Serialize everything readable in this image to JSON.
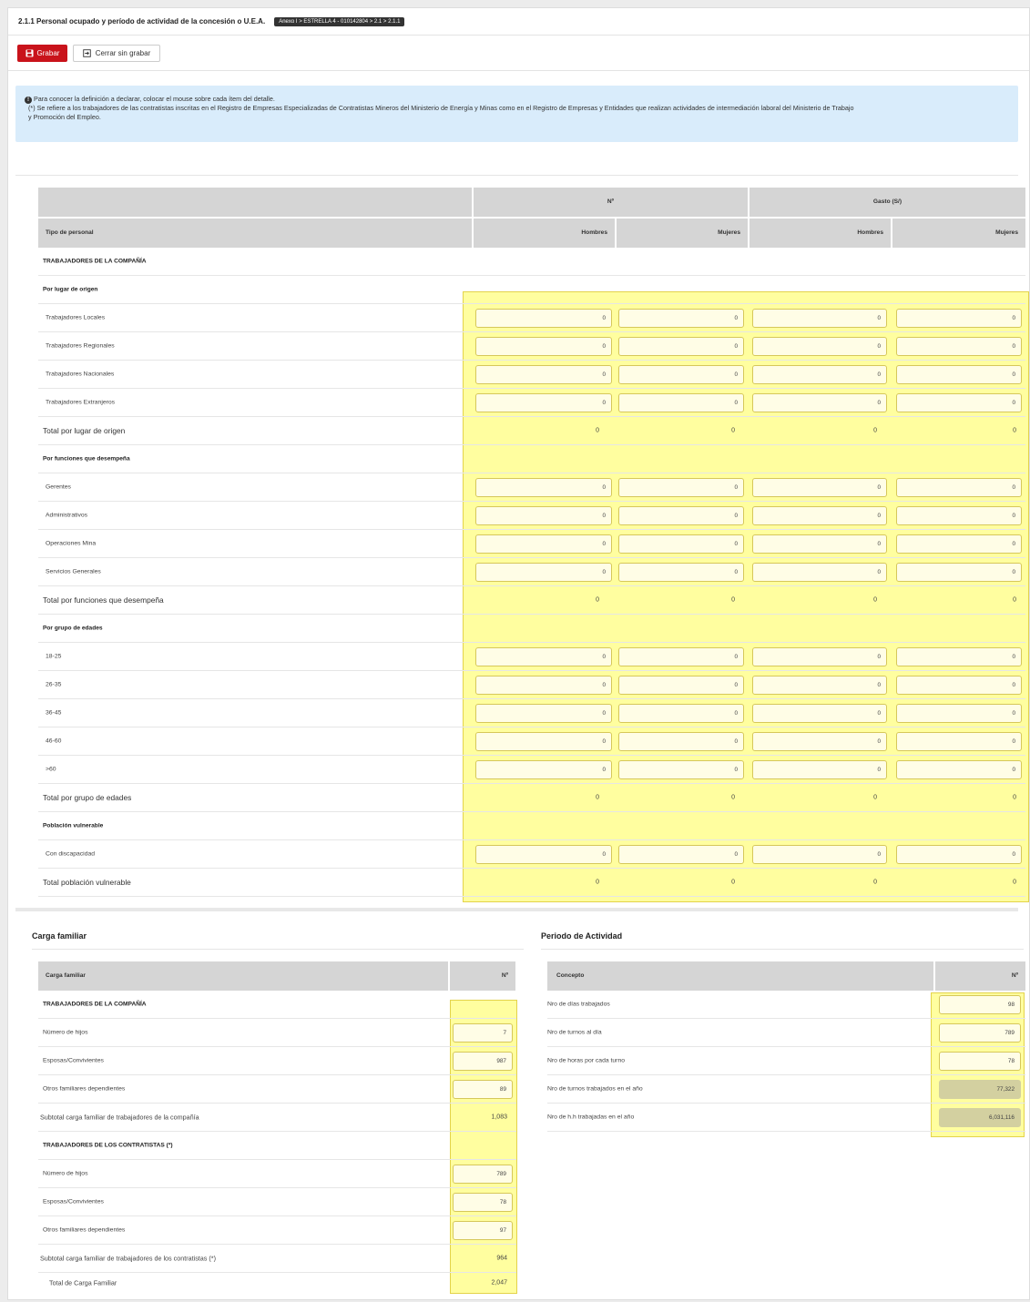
{
  "header": {
    "title": "2.1.1 Personal ocupado y período de actividad de la concesión o U.E.A.",
    "breadcrumb": "Anexo I > ESTRELLA 4 - 010142804 > 2.1 > 2.1.1"
  },
  "toolbar": {
    "save_label": "Grabar",
    "close_label": "Cerrar sin grabar"
  },
  "info": {
    "line1": "Para conocer la definición a declarar, colocar el mouse sobre cada ítem del detalle.",
    "line2": "(*) Se refiere a los trabajadores de las contratistas inscritas en el Registro de Empresas Especializadas de Contratistas Mineros del Ministerio de Energía y Minas como en el Registro de Empresas y Entidades que realizan actividades de intermediación laboral del Ministerio de Trabajo",
    "line3": "y Promoción del Empleo."
  },
  "main_table": {
    "group_n": "Nº",
    "group_gasto": "Gasto (S/)",
    "col_tipo": "Tipo de personal",
    "col_hombres": "Hombres",
    "col_mujeres": "Mujeres",
    "rows": [
      {
        "type": "section",
        "label": "TRABAJADORES DE LA COMPAÑÍA"
      },
      {
        "type": "section",
        "label": "Por lugar de origen"
      },
      {
        "type": "input",
        "label": "Trabajadores Locales",
        "values": [
          "0",
          "0",
          "0",
          "0"
        ]
      },
      {
        "type": "input",
        "label": "Trabajadores Regionales",
        "values": [
          "0",
          "0",
          "0",
          "0"
        ]
      },
      {
        "type": "input",
        "label": "Trabajadores Nacionales",
        "values": [
          "0",
          "0",
          "0",
          "0"
        ]
      },
      {
        "type": "input",
        "label": "Trabajadores Extranjeros",
        "values": [
          "0",
          "0",
          "0",
          "0"
        ]
      },
      {
        "type": "total",
        "label": "Total por lugar de origen",
        "values": [
          "0",
          "0",
          "0",
          "0"
        ]
      },
      {
        "type": "section",
        "label": "Por funciones que desempeña"
      },
      {
        "type": "input",
        "label": "Gerentes",
        "values": [
          "0",
          "0",
          "0",
          "0"
        ]
      },
      {
        "type": "input",
        "label": "Administrativos",
        "values": [
          "0",
          "0",
          "0",
          "0"
        ]
      },
      {
        "type": "input",
        "label": "Operaciones Mina",
        "values": [
          "0",
          "0",
          "0",
          "0"
        ]
      },
      {
        "type": "input",
        "label": "Servicios Generales",
        "values": [
          "0",
          "0",
          "0",
          "0"
        ]
      },
      {
        "type": "total",
        "label": "Total por funciones que desempeña",
        "values": [
          "0",
          "0",
          "0",
          "0"
        ]
      },
      {
        "type": "section",
        "label": "Por grupo de edades"
      },
      {
        "type": "input",
        "label": "18-25",
        "values": [
          "0",
          "0",
          "0",
          "0"
        ]
      },
      {
        "type": "input",
        "label": "26-35",
        "values": [
          "0",
          "0",
          "0",
          "0"
        ]
      },
      {
        "type": "input",
        "label": "36-45",
        "values": [
          "0",
          "0",
          "0",
          "0"
        ]
      },
      {
        "type": "input",
        "label": "46-60",
        "values": [
          "0",
          "0",
          "0",
          "0"
        ]
      },
      {
        "type": "input",
        "label": ">60",
        "values": [
          "0",
          "0",
          "0",
          "0"
        ]
      },
      {
        "type": "total",
        "label": "Total por grupo de edades",
        "values": [
          "0",
          "0",
          "0",
          "0"
        ]
      },
      {
        "type": "section",
        "label": "Población vulnerable"
      },
      {
        "type": "input",
        "label": "Con discapacidad",
        "values": [
          "0",
          "0",
          "0",
          "0"
        ]
      },
      {
        "type": "total",
        "label": "Total población vulnerable",
        "values": [
          "0",
          "0",
          "0",
          "0"
        ]
      }
    ]
  },
  "carga": {
    "title": "Carga familiar",
    "col_label": "Carga familiar",
    "col_n": "Nº",
    "rows": [
      {
        "type": "section",
        "label": "TRABAJADORES DE LA COMPAÑÍA"
      },
      {
        "type": "input",
        "label": "Número de hijos",
        "value": "7"
      },
      {
        "type": "input",
        "label": "Esposas/Convivientes",
        "value": "987"
      },
      {
        "type": "input",
        "label": "Otros familiares dependientes",
        "value": "89"
      },
      {
        "type": "total",
        "label": "Subtotal carga familiar de trabajadores de la compañía",
        "value": "1,083"
      },
      {
        "type": "section",
        "label": "TRABAJADORES DE LOS CONTRATISTAS (*)"
      },
      {
        "type": "input",
        "label": "Número de hijos",
        "value": "789"
      },
      {
        "type": "input",
        "label": "Esposas/Convivientes",
        "value": "78"
      },
      {
        "type": "input",
        "label": "Otros familiares dependientes",
        "value": "97"
      },
      {
        "type": "total",
        "label": "Subtotal carga familiar de trabajadores de los contratistas (*)",
        "value": "964"
      },
      {
        "type": "grand",
        "label": "Total de Carga Familiar",
        "value": "2,047"
      }
    ]
  },
  "periodo": {
    "title": "Periodo de Actividad",
    "col_label": "Concepto",
    "col_n": "Nº",
    "rows": [
      {
        "type": "input",
        "label": "Nro de días trabajados",
        "value": "98"
      },
      {
        "type": "input",
        "label": "Nro de turnos al día",
        "value": "789"
      },
      {
        "type": "input",
        "label": "Nro de horas por cada turno",
        "value": "78"
      },
      {
        "type": "readonly",
        "label": "Nro de turnos trabajados en el año",
        "value": "77,322"
      },
      {
        "type": "readonly",
        "label": "Nro de h.h trabajadas en el año",
        "value": "6,031,116"
      }
    ]
  },
  "colors": {
    "highlight": "#fffe9f",
    "save_button": "#c9131b",
    "info_bg": "#d9ecfb",
    "header_bg": "#d5d5d5"
  }
}
